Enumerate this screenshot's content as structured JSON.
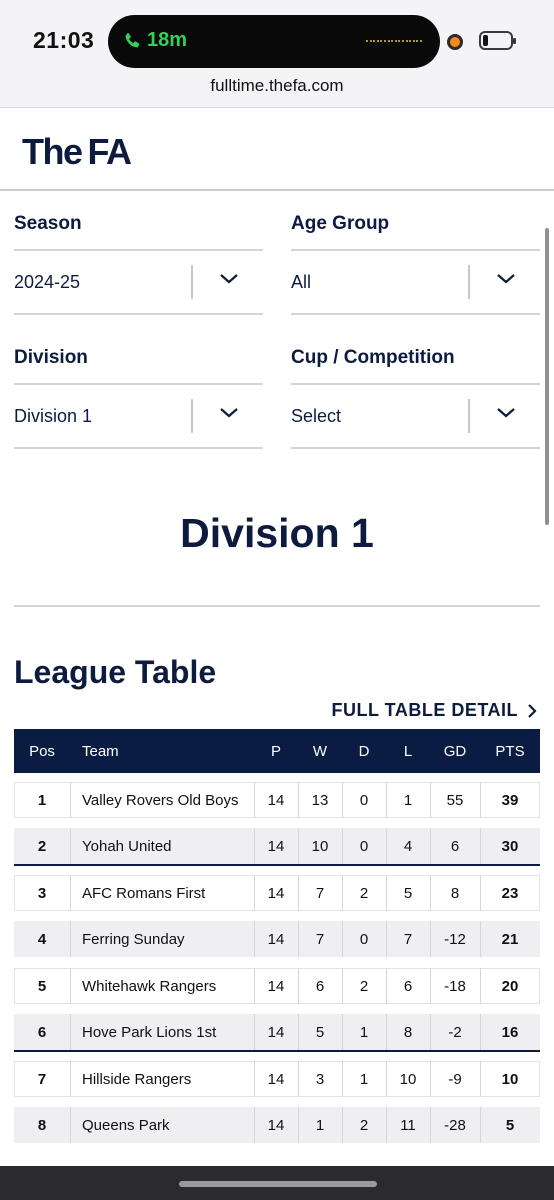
{
  "status": {
    "time": "21:03",
    "call_duration": "18m",
    "url": "fulltime.thefa.com"
  },
  "brand": {
    "logo_the": "The",
    "logo_fa": "FA"
  },
  "filters": {
    "season": {
      "label": "Season",
      "value": "2024-25"
    },
    "age_group": {
      "label": "Age Group",
      "value": "All"
    },
    "division": {
      "label": "Division",
      "value": "Division 1"
    },
    "cup": {
      "label": "Cup / Competition",
      "value": "Select"
    }
  },
  "division_title": "Division 1",
  "league_table": {
    "title": "League Table",
    "full_detail_link": "FULL TABLE DETAIL",
    "columns": {
      "pos": "Pos",
      "team": "Team",
      "p": "P",
      "w": "W",
      "d": "D",
      "l": "L",
      "gd": "GD",
      "pts": "PTS"
    },
    "rows": [
      {
        "pos": "1",
        "team": "Valley Rovers Old Boys",
        "p": "14",
        "w": "13",
        "d": "0",
        "l": "1",
        "gd": "55",
        "pts": "39"
      },
      {
        "pos": "2",
        "team": "Yohah United",
        "p": "14",
        "w": "10",
        "d": "0",
        "l": "4",
        "gd": "6",
        "pts": "30"
      },
      {
        "pos": "3",
        "team": "AFC Romans First",
        "p": "14",
        "w": "7",
        "d": "2",
        "l": "5",
        "gd": "8",
        "pts": "23"
      },
      {
        "pos": "4",
        "team": "Ferring Sunday",
        "p": "14",
        "w": "7",
        "d": "0",
        "l": "7",
        "gd": "-12",
        "pts": "21"
      },
      {
        "pos": "5",
        "team": "Whitehawk Rangers",
        "p": "14",
        "w": "6",
        "d": "2",
        "l": "6",
        "gd": "-18",
        "pts": "20"
      },
      {
        "pos": "6",
        "team": "Hove Park Lions 1st",
        "p": "14",
        "w": "5",
        "d": "1",
        "l": "8",
        "gd": "-2",
        "pts": "16"
      },
      {
        "pos": "7",
        "team": "Hillside Rangers",
        "p": "14",
        "w": "3",
        "d": "1",
        "l": "10",
        "gd": "-9",
        "pts": "10"
      },
      {
        "pos": "8",
        "team": "Queens Park",
        "p": "14",
        "w": "1",
        "d": "2",
        "l": "11",
        "gd": "-28",
        "pts": "5"
      }
    ]
  },
  "colors": {
    "navy": "#0b1c43",
    "call_green": "#33d158",
    "stripe": "#efeff2"
  },
  "icons": {
    "call": "phone-icon",
    "dropdown": "chevron-down-icon",
    "link_arrow": "chevron-right-icon"
  }
}
